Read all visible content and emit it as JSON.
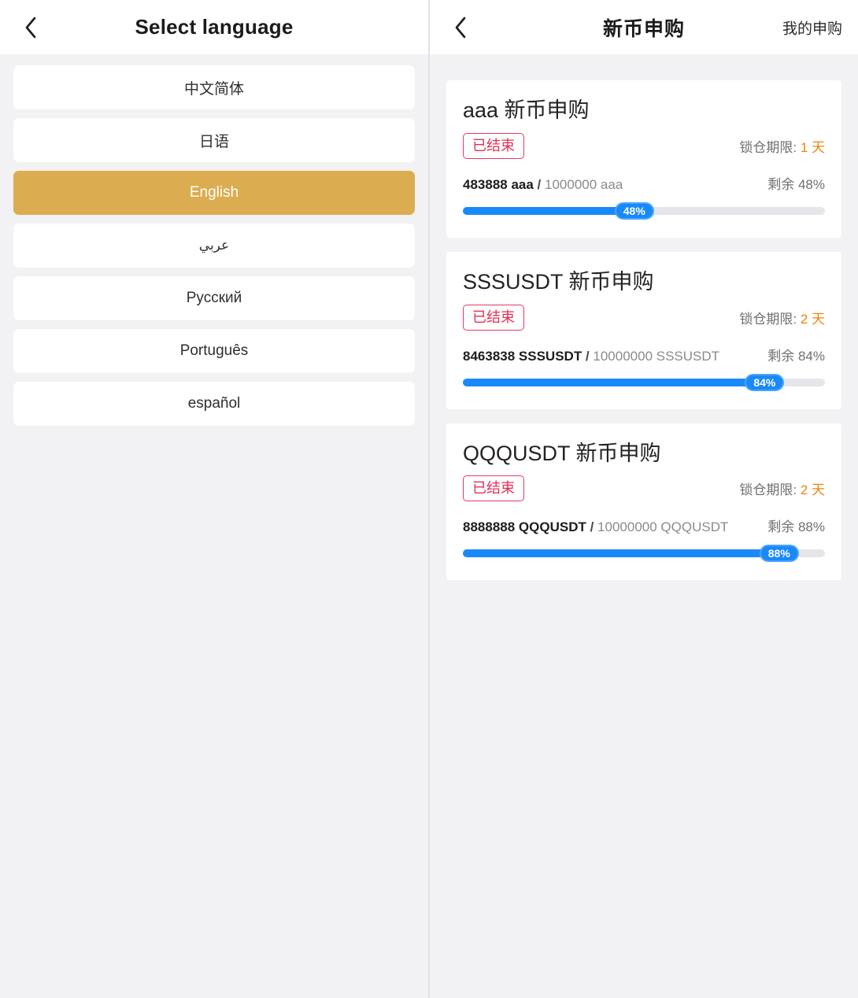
{
  "left": {
    "navbar": {
      "back_icon": "chevron-left-icon",
      "title": "Select language"
    },
    "languages": [
      {
        "label": "中文简体",
        "selected": false,
        "rtl": false
      },
      {
        "label": "日语",
        "selected": false,
        "rtl": false
      },
      {
        "label": "English",
        "selected": true,
        "rtl": false
      },
      {
        "label": "عربي",
        "selected": false,
        "rtl": true
      },
      {
        "label": "Русский",
        "selected": false,
        "rtl": false
      },
      {
        "label": "Português",
        "selected": false,
        "rtl": false
      },
      {
        "label": "español",
        "selected": false,
        "rtl": false
      }
    ],
    "selected_color": "#dcac50"
  },
  "right": {
    "navbar": {
      "back_icon": "chevron-left-icon",
      "title": "新币申购",
      "action": "我的申购"
    },
    "colors": {
      "progress": "#1989fa",
      "badge": "#e22f55",
      "lock_value": "#f2820c"
    },
    "cards": [
      {
        "title": "aaa 新币申购",
        "status": "已结束",
        "lock_label": "锁仓期限:",
        "lock_value": "1 天",
        "sold": "483888 aaa",
        "separator": "/",
        "total": "1000000 aaa",
        "remaining_label": "剩余 48%",
        "progress_label": "48%",
        "progress_percent": 48
      },
      {
        "title": "SSSUSDT 新币申购",
        "status": "已结束",
        "lock_label": "锁仓期限:",
        "lock_value": "2 天",
        "sold": "8463838 SSSUSDT",
        "separator": "/",
        "total": "10000000 SSSUSDT",
        "remaining_label": "剩余 84%",
        "progress_label": "84%",
        "progress_percent": 84
      },
      {
        "title": "QQQUSDT 新币申购",
        "status": "已结束",
        "lock_label": "锁仓期限:",
        "lock_value": "2 天",
        "sold": "8888888 QQQUSDT",
        "separator": "/",
        "total": "10000000 QQQUSDT",
        "remaining_label": "剩余 88%",
        "progress_label": "88%",
        "progress_percent": 88
      }
    ]
  }
}
